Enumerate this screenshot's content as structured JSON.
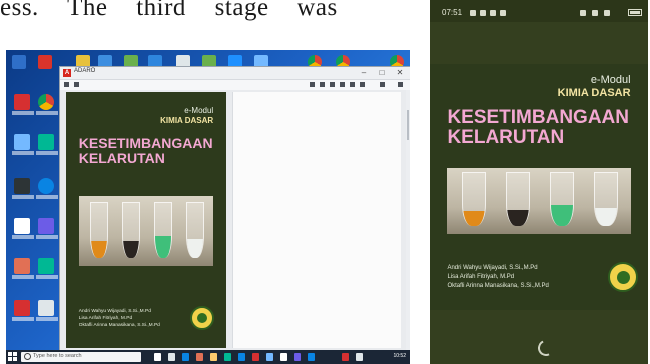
{
  "paragraph": {
    "text": "ess. The third stage was"
  },
  "desktop": {
    "window": {
      "app_logo": "A",
      "title": "ADARO",
      "minimize": "–",
      "maximize": "□",
      "close": "✕"
    },
    "cover": {
      "emodul": "e-Modul",
      "subject": "KIMIA DASAR",
      "title_line1": "KESETIMBANGAAN",
      "title_line2": "KELARUTAN",
      "authors": [
        "Andri Wahyu Wijayadi, S.Si.,M.Pd",
        "Lisa Arifah Fitriyah, M.Pd",
        "Oktafli Arinna Manasikana, S.Si.,M.Pd"
      ]
    },
    "taskbar": {
      "search_placeholder": "Type here to search",
      "time": "10:52"
    }
  },
  "phone": {
    "status_time": "07:51",
    "cover": {
      "emodul": "e-Modul",
      "subject": "KIMIA DASAR",
      "title_line1": "KESETIMBANGAAN",
      "title_line2": "KELARUTAN",
      "authors": [
        "Andri Wahyu Wijayadi, S.Si.,M.Pd",
        "Lisa Arifah Fitriyah, M.Pd",
        "Oktafli Arinna Manasikana, S.Si.,M.Pd"
      ]
    }
  },
  "colors": {
    "cover_bg": "#2d3a1c",
    "title_pink": "#f3a8d2",
    "subject_yellow": "#f2e4a3",
    "taskbar": "#1b2636"
  }
}
